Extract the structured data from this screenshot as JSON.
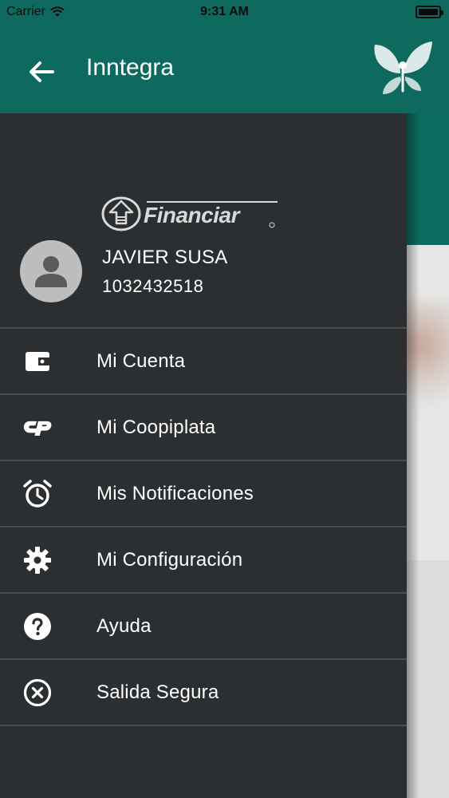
{
  "status_bar": {
    "carrier": "Carrier",
    "time": "9:31 AM",
    "wifi_icon": "wifi-icon",
    "battery_icon": "battery-icon"
  },
  "app_bar": {
    "title": "Inntegra",
    "back_icon": "arrow-back-icon",
    "logo_icon": "butterfly-logo"
  },
  "drawer": {
    "company_logo_text": "Financiar",
    "user": {
      "name": "JAVIER SUSA",
      "id": "1032432518",
      "avatar_icon": "person-icon"
    },
    "menu": [
      {
        "label": "Mi Cuenta",
        "icon": "wallet-icon"
      },
      {
        "label": "Mi Coopiplata",
        "icon": "coopiplata-icon"
      },
      {
        "label": "Mis Notificaciones",
        "icon": "alarm-icon"
      },
      {
        "label": "Mi Configuración",
        "icon": "gear-icon"
      },
      {
        "label": "Ayuda",
        "icon": "help-icon"
      },
      {
        "label": "Salida Segura",
        "icon": "close-circle-icon"
      }
    ]
  },
  "colors": {
    "primary": "#0e6a5e",
    "drawer_bg": "#2c2f31",
    "divider": "#4a4d4f",
    "text": "#ffffff"
  }
}
